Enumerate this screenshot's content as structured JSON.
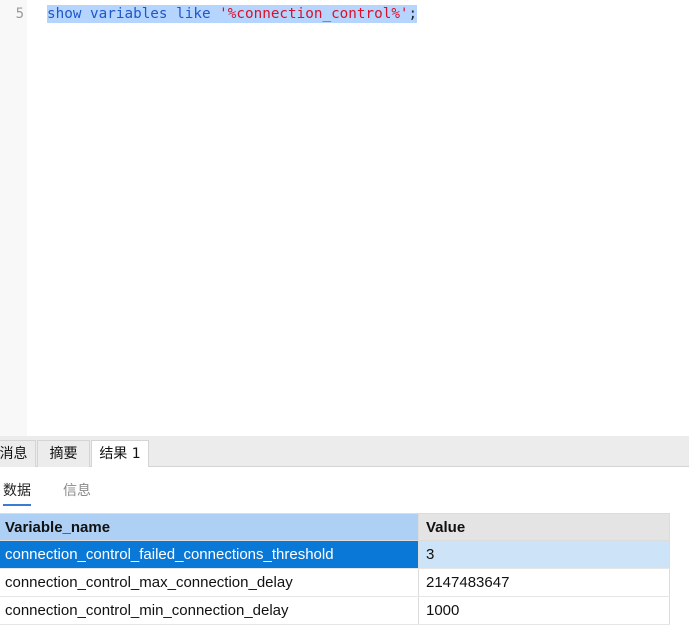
{
  "editor": {
    "line_number": "5",
    "tokens": {
      "show": "show",
      "variables": "variables",
      "like": "like",
      "pattern": "'%connection_control%'",
      "semicolon": ";"
    }
  },
  "result_tabs": {
    "messages": "消息",
    "summary": "摘要",
    "result1": "结果 1"
  },
  "sub_tabs": {
    "data": "数据",
    "info": "信息"
  },
  "grid": {
    "headers": [
      "Variable_name",
      "Value"
    ],
    "rows": [
      [
        "connection_control_failed_connections_threshold",
        "3"
      ],
      [
        "connection_control_max_connection_delay",
        "2147483647"
      ],
      [
        "connection_control_min_connection_delay",
        "1000"
      ]
    ],
    "selected_row": 0
  },
  "colors": {
    "keyword": "#1f57c9",
    "string": "#d8112a",
    "selection": "#b5d5ff",
    "row_selected": "#0a78d7"
  }
}
